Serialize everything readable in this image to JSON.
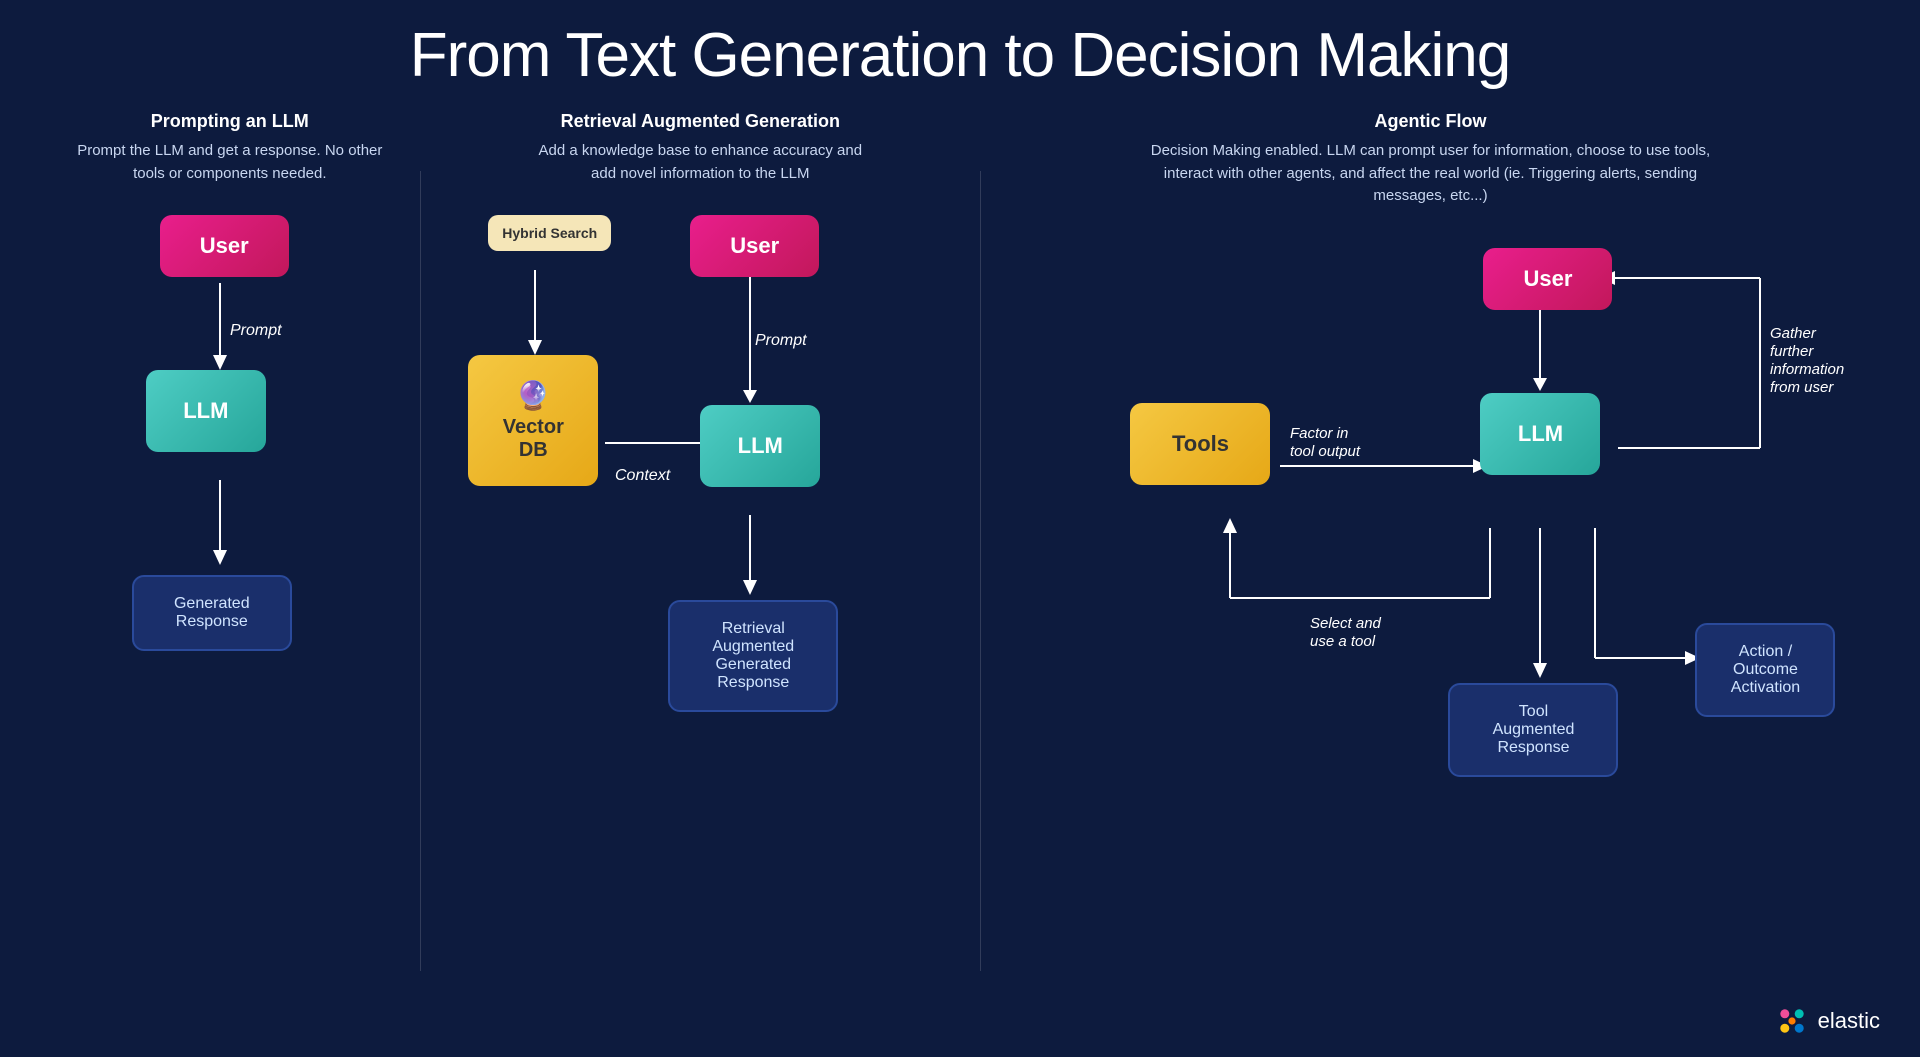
{
  "title": "From Text Generation to Decision Making",
  "columns": [
    {
      "id": "col1",
      "header": "Prompting an LLM",
      "description": "Prompt the LLM and get a response. No other tools or components needed."
    },
    {
      "id": "col2",
      "header": "Retrieval Augmented Generation",
      "description": "Add a knowledge base to enhance accuracy and add novel information to the LLM"
    },
    {
      "id": "col3",
      "header": "Agentic Flow",
      "description": "Decision Making enabled. LLM can prompt user for information, choose to use tools, interact with other agents, and affect the real world (ie. Triggering alerts, sending messages, etc...)"
    }
  ],
  "nodes": {
    "user": "User",
    "llm": "LLM",
    "generated_response": "Generated\nResponse",
    "rag_response": "Retrieval\nAugmented\nGenerated\nResponse",
    "tool_response": "Tool\nAugmented\nResponse",
    "vectordb": "Vector\nDB",
    "tools": "Tools",
    "action": "Action /\nOutcome\nActivation",
    "hybrid_search": "Hybrid\nSearch"
  },
  "labels": {
    "prompt": "Prompt",
    "context": "Context",
    "factor_in_tool": "Factor in\ntool output",
    "select_tool": "Select and\nuse a tool",
    "gather_info": "Gather\nfurther\ninformation\nfrom user"
  },
  "elastic": {
    "label": "elastic"
  }
}
